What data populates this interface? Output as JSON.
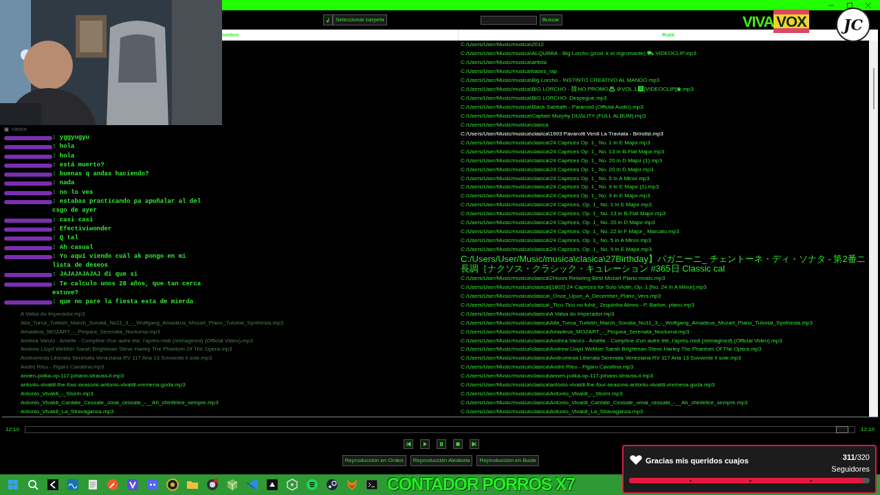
{
  "toolbar": {
    "folder_button": "Seleccionar carpeta",
    "search_button": "Buscar"
  },
  "logo": {
    "first": "VIVA",
    "second": "VOX"
  },
  "channel_badge": "JC",
  "table": {
    "columns": [
      "ombre",
      "Ruta"
    ],
    "rows": [
      {
        "path": "C:/Users/User/Music/musica\\2012",
        "selected": false
      },
      {
        "path": "C:/Users/User/Music/musica\\ALQUIMIA - Big Lorcho (prod. k el nigromante) ⛟ VIDEOCLIP.mp3",
        "selected": false
      },
      {
        "path": "C:/Users/User/Music/musica\\artista",
        "selected": false
      },
      {
        "path": "C:/Users/User/Music/musica\\bases_rap",
        "selected": false
      },
      {
        "path": "C:/Users/User/Music/musica\\Big Lorcho - INSTINTO CREATIVO AL MANDO.mp3",
        "selected": false
      },
      {
        "path": "C:/Users/User/Music/musica\\BIG LORCHO - ⛓NO PROMO♨ ⊘VOL.1☸[VIDEOCLIP]◉.mp3",
        "selected": false
      },
      {
        "path": "C:/Users/User/Music/musica\\BIG LORCHO- Despegue.mp3",
        "selected": false
      },
      {
        "path": "C:/Users/User/Music/musica\\Black Sabbath - Paranoid (Official Audio).mp3",
        "selected": false
      },
      {
        "path": "C:/Users/User/Music/musica\\Captain Murphy  DUΔLITY (FULL ALBUM).mp3",
        "selected": false
      },
      {
        "path": "C:/Users/User/Music/musica\\clasica",
        "selected": false
      },
      {
        "path": "C:/Users/User/Music/musica\\clasica\\1993 Pavarotti Verdi La Traviata - Brindisi.mp3",
        "selected": true
      },
      {
        "path": "C:/Users/User/Music/musica\\clasica\\24 Caprices Op. 1_ No. 1 in E Major.mp3",
        "selected": false
      },
      {
        "path": "C:/Users/User/Music/musica\\clasica\\24 Caprices Op. 1_ No. 13 in B-Flat Major.mp3",
        "selected": false
      },
      {
        "path": "C:/Users/User/Music/musica\\clasica\\24 Caprices Op. 1_ No. 20 in D Major (1).mp3",
        "selected": false
      },
      {
        "path": "C:/Users/User/Music/musica\\clasica\\24 Caprices Op. 1_ No. 20 in D Major.mp3",
        "selected": false
      },
      {
        "path": "C:/Users/User/Music/musica\\clasica\\24 Caprices Op. 1_ No. 5 in A Minor.mp3",
        "selected": false
      },
      {
        "path": "C:/Users/User/Music/musica\\clasica\\24 Caprices Op. 1_ No. 9 in E Major (1).mp3",
        "selected": false
      },
      {
        "path": "C:/Users/User/Music/musica\\clasica\\24 Caprices Op. 1_ No. 9 in E Major.mp3",
        "selected": false
      },
      {
        "path": "C:/Users/User/Music/musica\\clasica\\24 Caprices, Op. 1_ No. 1 in E Major.mp3",
        "selected": false
      },
      {
        "path": "C:/Users/User/Music/musica\\clasica\\24 Caprices, Op. 1_ No. 13 in B-Flat Major.mp3",
        "selected": false
      },
      {
        "path": "C:/Users/User/Music/musica\\clasica\\24 Caprices, Op. 1_ No. 20 in D Major.mp3",
        "selected": false
      },
      {
        "path": "C:/Users/User/Music/musica\\clasica\\24 Caprices, Op. 1_ No. 22 in F Major_ Marcato.mp3",
        "selected": false
      },
      {
        "path": "C:/Users/User/Music/musica\\clasica\\24 Caprices, Op. 1_ No. 5 in A Minor.mp3",
        "selected": false
      },
      {
        "path": "C:/Users/User/Music/musica\\clasica\\24 Caprices, Op. 1_ No. 9 in E Major.mp3",
        "selected": false
      },
      {
        "path": "C:/Users/User/Music/musica\\clasica\\27Birthday】パガニーニ_ チェントーネ・ディ・ソナタ - 第2番ニ長調［ナクソス・クラシック・キュレーション #365日 Classic cal",
        "selected": false
      },
      {
        "path": "C:/Users/User/Music/musica\\clasica\\2Hours Relaxing Best Mozart Piano music.mp3",
        "selected": false
      },
      {
        "path": "C:/Users/User/Music/musica\\clasica\\[1802] 24 Caprices for Solo Violin, Op. 1 [No. 24 in A Minor].mp3",
        "selected": false
      },
      {
        "path": "C:/Users/User/Music/musica\\clasica\\_Once_Upon_A_December_Piano_Vers.mp3",
        "selected": false
      },
      {
        "path": "C:/Users/User/Music/musica\\clasica\\_Tico-Tico no fubá_ Zequinha Abreu - P. Barton, piano.mp3",
        "selected": false
      },
      {
        "name": "A Valsa do Imperador.mp3",
        "dimmed": true,
        "path": "C:/Users/User/Music/musica\\clasica\\A Valsa do Imperador.mp3",
        "selected": false
      },
      {
        "name": "Alla_Turca_Turkish_March_Sonata_No11_3_-_Wolfgang_Amadeus_Mozart_Piano_Tutorial_Synthesia.mp3",
        "dimmed": true,
        "path": "C:/Users/User/Music/musica\\clasica\\Alla_Turca_Turkish_March_Sonata_No11_3_-_Wolfgang_Amadeus_Mozart_Piano_Tutorial_Synthesia.mp3",
        "selected": false
      },
      {
        "name": "Amadeus_MOZART_-_Pequea_Serenata_Nocturna.mp3",
        "dimmed": true,
        "path": "C:/Users/User/Music/musica\\clasica\\Amadeus_MOZART_-_Pequea_Serenata_Nocturna.mp3",
        "selected": false
      },
      {
        "name": "Andrea Vanzo - Amélie - Comptine d'un autre été, l'après-midi (reimagined) (Official Video).mp3",
        "dimmed": true,
        "path": "C:/Users/User/Music/musica\\clasica\\Andrea Vanzo - Amélie - Comptine d'un autre été, l'après-midi (reimagined) (Official Video).mp3",
        "selected": false
      },
      {
        "name": "Andrew Lloyd Webber Sarah Brightman Steve Harley  The Phantom Of The Opera.mp3",
        "dimmed": true,
        "path": "C:/Users/User/Music/musica\\clasica\\Andrew Lloyd Webber Sarah Brightman Steve Harley  The Phantom Of The Opera.mp3",
        "selected": false
      },
      {
        "name": "Andromeda Liberata Serenata Veneziana  RV 117  Aria 13 Sovvente il sole.mp3",
        "dimmed": true,
        "path": "C:/Users/User/Music/musica\\clasica\\Andromeda Liberata Serenata Veneziana  RV 117  Aria 13 Sovvente il sole.mp3",
        "selected": false
      },
      {
        "name": "André Rieu - Figaro Cavatina.mp3",
        "dimmed": true,
        "path": "C:/Users/User/Music/musica\\clasica\\André Rieu - Figaro Cavatina.mp3",
        "selected": false
      },
      {
        "name": "annen-polka-op-117-johann-strauss-ii.mp3",
        "dimmed": false,
        "path": "C:/Users/User/Music/musica\\clasica\\annen-polka-op-117-johann-strauss-ii.mp3",
        "selected": false
      },
      {
        "name": "antonio-vivaldi-the-four-seasons-antonio-vivaldi-vremena-goda.mp3",
        "dimmed": false,
        "path": "C:/Users/User/Music/musica\\clasica\\antonio-vivaldi-the-four-seasons-antonio-vivaldi-vremena-goda.mp3",
        "selected": false
      },
      {
        "name": "Antonio_Vivaldi_-_Storm.mp3",
        "dimmed": false,
        "path": "C:/Users/User/Music/musica\\clasica\\Antonio_Vivaldi_-_Storm.mp3",
        "selected": false
      },
      {
        "name": "Antonio_Vivaldi_Cantate_Cessate_omai_cessate_-__Ah_chinfelice_sempre.mp3",
        "dimmed": false,
        "path": "C:/Users/User/Music/musica\\clasica\\Antonio_Vivaldi_Cantate_Cessate_omai_cessate_-__Ah_chinfelice_sempre.mp3",
        "selected": false
      },
      {
        "name": "Antonio_Vivaldi_La_Stravaganza.mp3",
        "dimmed": false,
        "path": "C:/Users/User/Music/musica\\clasica\\Antonio_Vivaldi_La_Stravaganza.mp3",
        "selected": false
      }
    ]
  },
  "folder_label": "clasica",
  "chat": [
    {
      "message": ": yggyugyu"
    },
    {
      "message": ": hola"
    },
    {
      "message": ": hola"
    },
    {
      "message": ": está muerto?"
    },
    {
      "message": ": buenas q andas haciendo?"
    },
    {
      "message": ": nada"
    },
    {
      "message": ": no lo ves"
    },
    {
      "message": ": estabas practicando pa apuñalar al del csgo de ayer"
    },
    {
      "message": ": casi casi"
    },
    {
      "message": ": Efectiviwonder"
    },
    {
      "message": ": Q tal"
    },
    {
      "message": ": Ah casual"
    },
    {
      "message": ": Yo aquí viendo cuál ak pongo en mi lista de deseos"
    },
    {
      "message": ": JAJAJAJAJAJ di que si"
    },
    {
      "message": ": Te calculo unos 28 años, que tan cerca estuve?"
    },
    {
      "message": ": que no pare la fiesta esta de mierda"
    }
  ],
  "player": {
    "elapsed": "12:10",
    "total": "12:10",
    "level": 0.985,
    "modes": [
      "Reproducción en Orden",
      "Reproducción Aleatoria",
      "Reproducción en Bucle"
    ]
  },
  "counter_overlay": "CONTADOR PORROS X7",
  "follower_goal": {
    "title": "Gracias mis queridos cuajos",
    "count": "**311**/320",
    "label": "Seguidores",
    "level": 0.97
  }
}
